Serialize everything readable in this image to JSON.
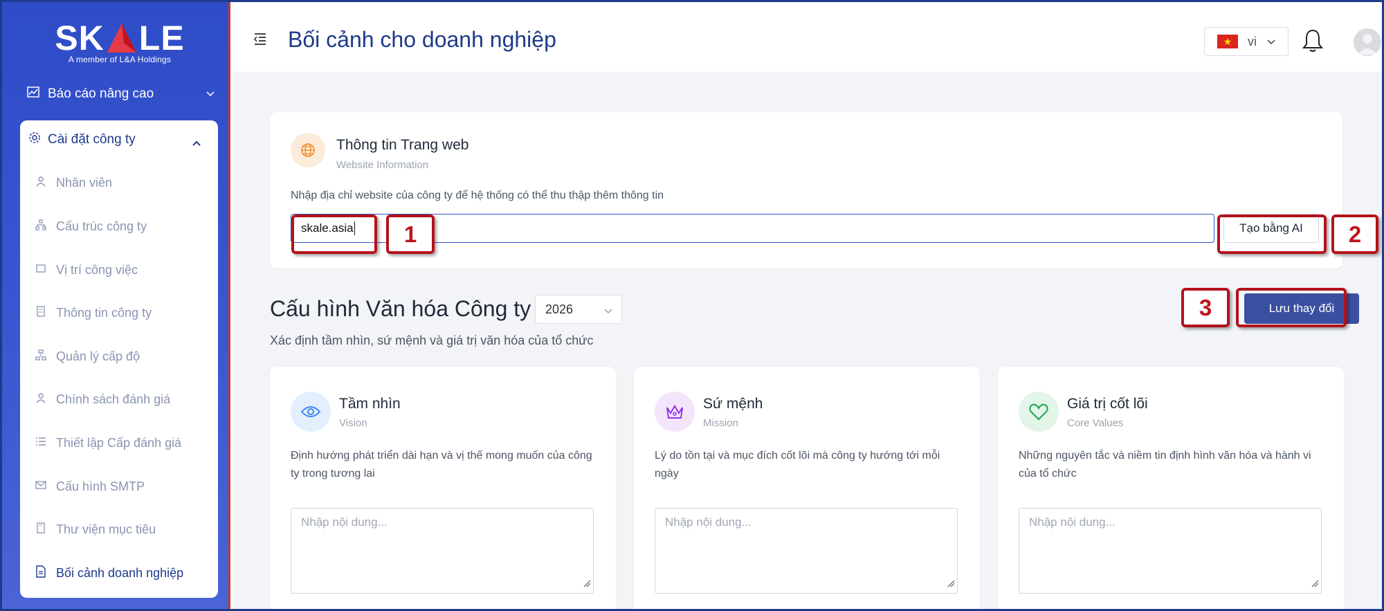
{
  "brand": {
    "logo_word_left": "SK",
    "logo_word_right": "LE",
    "tagline": "A member of L&A Holdings"
  },
  "sidebar": {
    "report": {
      "label": "Báo cáo nâng cao",
      "icon": "chart-icon"
    },
    "company_settings": {
      "label": "Cài đặt công ty",
      "icon": "gear-icon",
      "items": [
        {
          "label": "Nhân viên",
          "icon": "user-icon"
        },
        {
          "label": "Cấu trúc công ty",
          "icon": "org-icon"
        },
        {
          "label": "Vị trí công việc",
          "icon": "position-icon"
        },
        {
          "label": "Thông tin công ty",
          "icon": "building-icon"
        },
        {
          "label": "Quản lý cấp độ",
          "icon": "level-icon"
        },
        {
          "label": "Chính sách đánh giá",
          "icon": "policy-icon"
        },
        {
          "label": "Thiết lập Cấp đánh giá",
          "icon": "list-icon"
        },
        {
          "label": "Cấu hình SMTP",
          "icon": "mail-icon"
        },
        {
          "label": "Thư viện mục tiêu",
          "icon": "bookmark-icon"
        },
        {
          "label": "Bối cảnh doanh nghiệp",
          "icon": "document-icon",
          "active": true
        }
      ]
    }
  },
  "header": {
    "title": "Bối cảnh cho doanh nghiệp",
    "language": "vi"
  },
  "website_card": {
    "title": "Thông tin Trang web",
    "subtitle": "Website Information",
    "description": "Nhập địa chỉ website của công ty để hệ thống có thể thu thập thêm thông tin",
    "url_value": "skale.asia",
    "ai_button": "Tạo bằng AI"
  },
  "culture": {
    "title": "Cấu hình Văn hóa Công ty",
    "year": "2026",
    "subtitle": "Xác định tầm nhìn, sứ mệnh và giá trị văn hóa của tổ chức",
    "save_button": "Lưu thay đổi",
    "cards": [
      {
        "title": "Tầm nhìn",
        "subtitle": "Vision",
        "description": "Định hướng phát triển dài hạn và vị thế mong muốn của công ty trong tương lai",
        "placeholder": "Nhập nội dung...",
        "icon": "eye-icon",
        "color": "#3b82f6"
      },
      {
        "title": "Sứ mệnh",
        "subtitle": "Mission",
        "description": "Lý do tồn tại và mục đích cốt lõi mà công ty hướng tới mỗi ngày",
        "placeholder": "Nhập nội dung...",
        "icon": "crown-icon",
        "color": "#9333ea"
      },
      {
        "title": "Giá trị cốt lõi",
        "subtitle": "Core Values",
        "description": "Những nguyên tắc và niềm tin định hình văn hóa và hành vi của tổ chức",
        "placeholder": "Nhập nội dung...",
        "icon": "heart-icon",
        "color": "#16a34a"
      }
    ]
  },
  "annotations": [
    "1",
    "2",
    "3"
  ],
  "colors": {
    "sidebar": "#2f4cc7",
    "primary": "#1e3a8a",
    "button": "#3b4fa0",
    "annotation": "#b3121b"
  }
}
